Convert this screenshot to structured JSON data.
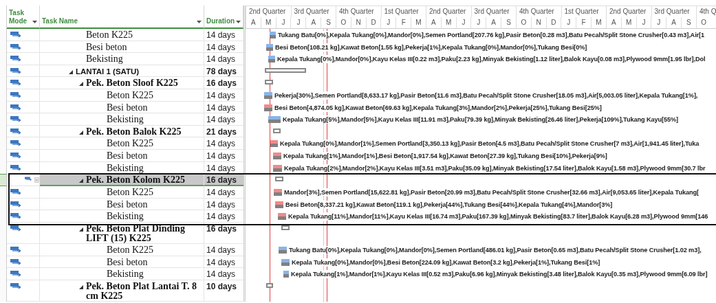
{
  "columns": [
    {
      "label": "Task Mode"
    },
    {
      "label": "Task Name"
    },
    {
      "label": "Duration"
    }
  ],
  "timescale": {
    "quarters": [
      "2nd Quarter",
      "3rd Quarter",
      "4th Quarter",
      "1st Quarter",
      "2nd Quarter",
      "3rd Quarter",
      "4th Quarter",
      "1st Quarter",
      "2nd Quarter",
      "3rd Quarter",
      "4th Q"
    ],
    "months": [
      "A",
      "M",
      "J",
      "J",
      "A",
      "S",
      "O",
      "N",
      "D",
      "J",
      "F",
      "M",
      "A",
      "M",
      "J",
      "J",
      "A",
      "S",
      "O",
      "N",
      "D",
      "J",
      "F",
      "M",
      "A",
      "M",
      "J",
      "J",
      "A",
      "S",
      "O"
    ]
  },
  "tasks": [
    {
      "kind": "task",
      "name": "Beton K225",
      "duration": "14 days",
      "critical": false,
      "selected": false,
      "boxed": false,
      "resources": "Tukang Batu[0%],Kepala Tukang[0%],Mandor[0%],Semen Portland[207.76 kg],Pasir Beton[0.28 m3],Batu Pecah/Split Stone Crusher[0.43 m3],Air[1"
    },
    {
      "kind": "task",
      "name": "Besi beton",
      "duration": "14 days",
      "critical": false,
      "selected": false,
      "boxed": false,
      "resources": "Besi Beton[108.21 kg],Kawat Beton[1.55 kg],Pekerja[1%],Kepala Tukang[0%],Mandor[0%],Tukang Besi[0%]"
    },
    {
      "kind": "task",
      "name": "Bekisting",
      "duration": "14 days",
      "critical": false,
      "selected": false,
      "boxed": false,
      "resources": "Kepala Tukang[0%],Mandor[0%],Kayu Kelas III[0.22 m3],Paku[2.23 kg],Minyak Bekisting[1.12 liter],Balok Kayu[0.08 m3],Plywood 9mm[1.95 lbr],Dol"
    },
    {
      "kind": "summary",
      "name": "LANTAI 1 (SATU)",
      "duration": "78 days",
      "selected": false,
      "boxed": false,
      "expanded": true,
      "children": [
        {
          "kind": "summary",
          "name": "Pek. Beton Sloof K225",
          "duration": "16 days",
          "selected": false,
          "boxed": false,
          "expanded": true,
          "children": [
            {
              "kind": "task",
              "name": "Beton K225",
              "duration": "14 days",
              "critical": false,
              "selected": false,
              "boxed": false,
              "resources": "Pekerja[30%],Semen Portland[8,633.17 kg],Pasir Beton[11.6 m3],Batu Pecah/Split Stone Crusher[18.05 m3],Air[5,003.05 liter],Kepala Tukang[1%],"
            },
            {
              "kind": "task",
              "name": "Besi beton",
              "duration": "14 days",
              "critical": true,
              "selected": false,
              "boxed": false,
              "resources": "Besi Beton[4,874.05 kg],Kawat Beton[69.63 kg],Kepala Tukang[3%],Mandor[2%],Pekerja[25%],Tukang Besi[25%]"
            },
            {
              "kind": "task",
              "name": "Bekisting",
              "duration": "14 days",
              "critical": false,
              "selected": false,
              "boxed": false,
              "resources": "Kepala Tukang[5%],Mandor[5%],Kayu Kelas III[11.91 m3],Paku[79.39 kg],Minyak Bekisting[26.46 liter],Pekerja[109%],Tukang Kayu[55%]"
            }
          ]
        },
        {
          "kind": "summary",
          "name": "Pek. Beton Balok K225",
          "duration": "21 days",
          "selected": false,
          "boxed": false,
          "expanded": true,
          "children": [
            {
              "kind": "task",
              "name": "Beton K225",
              "duration": "14 days",
              "critical": true,
              "selected": false,
              "boxed": false,
              "resources": "Kepala Tukang[0%],Mandor[1%],Semen Portland[3,350.13 kg],Pasir Beton[4.5 m3],Batu Pecah/Split Stone Crusher[7 m3],Air[1,941.45 liter],Tuka"
            },
            {
              "kind": "task",
              "name": "Besi beton",
              "duration": "14 days",
              "critical": true,
              "selected": false,
              "boxed": false,
              "resources": "Kepala Tukang[1%],Mandor[1%],Besi Beton[1,917.54 kg],Kawat Beton[27.39 kg],Tukang Besi[10%],Pekerja[9%]"
            },
            {
              "kind": "task",
              "name": "Bekisting",
              "duration": "14 days",
              "critical": true,
              "selected": false,
              "boxed": false,
              "resources": "Kepala Tukang[2%],Mandor[2%],Kayu Kelas III[3.51 m3],Paku[35.09 kg],Minyak Bekisting[17.54 liter],Balok Kayu[1.58 m3],Plywood 9mm[30.7 lbr"
            }
          ]
        },
        {
          "kind": "summary",
          "name": "Pek. Beton Kolom K225",
          "duration": "16 days",
          "selected": true,
          "boxed": true,
          "expanded": true,
          "children": [
            {
              "kind": "task",
              "name": "Beton K225",
              "duration": "14 days",
              "critical": true,
              "selected": false,
              "boxed": false,
              "resources": "Mandor[3%],Semen Portland[15,622.81 kg],Pasir Beton[20.99 m3],Batu Pecah/Split Stone Crusher[32.66 m3],Air[9,053.65 liter],Kepala Tukang["
            },
            {
              "kind": "task",
              "name": "Besi beton",
              "duration": "14 days",
              "critical": true,
              "selected": false,
              "boxed": false,
              "resources": "Besi Beton[8,337.21 kg],Kawat Beton[119.1 kg],Pekerja[44%],Tukang Besi[44%],Kepala Tukang[4%],Mandor[3%]"
            },
            {
              "kind": "task",
              "name": "Bekisting",
              "duration": "14 days",
              "critical": true,
              "selected": false,
              "boxed": false,
              "resources": "Kepala Tukang[11%],Mandor[11%],Kayu Kelas III[16.74 m3],Paku[167.39 kg],Minyak Bekisting[83.7 liter],Balok Kayu[6.28 m3],Plywood 9mm[146"
            }
          ]
        },
        {
          "kind": "summary",
          "name": "Pek. Beton Plat Dinding LIFT (15) K225",
          "duration": "16 days",
          "selected": false,
          "boxed": false,
          "expanded": true,
          "children": [
            {
              "kind": "task",
              "name": "Beton K225",
              "duration": "14 days",
              "critical": false,
              "selected": false,
              "boxed": false,
              "resources": "Tukang Batu[0%],Kepala Tukang[0%],Mandor[0%],Semen Portland[486.01 kg],Pasir Beton[0.65 m3],Batu Pecah/Split Stone Crusher[1.02 m3],"
            },
            {
              "kind": "task",
              "name": "Besi beton",
              "duration": "14 days",
              "critical": false,
              "selected": false,
              "boxed": false,
              "resources": "Kepala Tukang[0%],Mandor[0%],Besi Beton[224.09 kg],Kawat Beton[3.2 kg],Pekerja[1%],Tukang Besi[1%]"
            },
            {
              "kind": "task",
              "name": "Bekisting",
              "duration": "14 days",
              "critical": false,
              "selected": false,
              "boxed": false,
              "resources": "Kepala Tukang[1%],Mandor[1%],Kayu Kelas III[0.52 m3],Paku[6.96 kg],Minyak Bekisting[3.48 liter],Balok Kayu[0.35 m3],Plywood 9mm[6.09 lbr]"
            }
          ]
        },
        {
          "kind": "summary",
          "name": "Pek. Beton Plat Lantai T. 8 cm K225",
          "duration": "10 days",
          "selected": false,
          "boxed": false,
          "expanded": true
        }
      ]
    }
  ]
}
